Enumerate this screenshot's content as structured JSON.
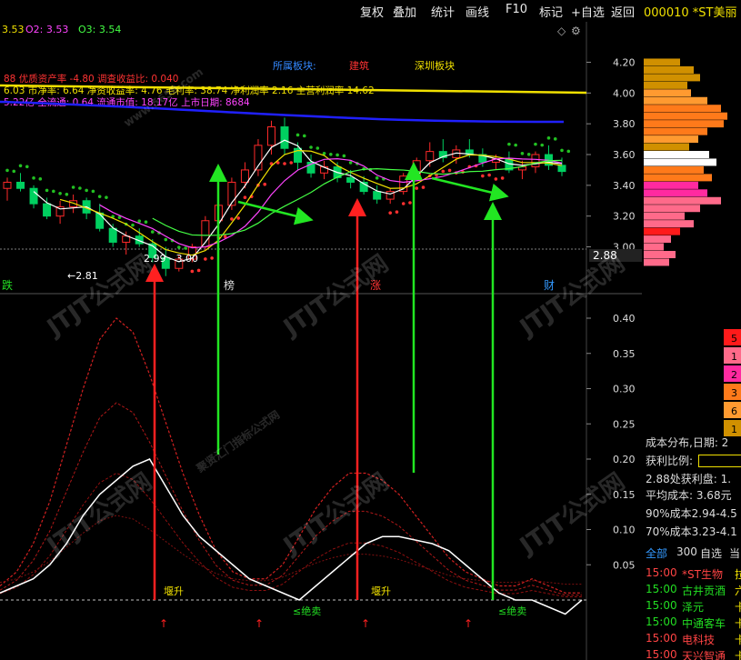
{
  "topbar": {
    "items": [
      "复权",
      "叠加",
      "统计",
      "画线",
      "F10",
      "标记",
      "+自选",
      "返回"
    ],
    "code": "000010 *ST美丽"
  },
  "ma_line": {
    "o1": "3.53",
    "o2": "O2: 3.53",
    "o3": "O3: 3.54"
  },
  "sector_row": {
    "label": "所属板块:",
    "sector1": "建筑",
    "sector2": "深圳板块"
  },
  "fund_rows": [
    "88 优质资产率 -4.80 调查收益比: 0.040",
    "6.03 市净率: 6.64 净资收益率: 4.76 毛利率: 38.74 净利润率 2.16 主营利润率 14.62",
    "5.22亿 全流通: 0.64 流通市值: 18.17亿 上市日期: 8684"
  ],
  "price_axis": [
    "4.20",
    "4.00",
    "3.80",
    "3.60",
    "3.40",
    "3.20",
    "3.00"
  ],
  "current_price": "2.88",
  "price_annotations": {
    "low_label": "←2.81",
    "range_label": "2.99 - 3.00"
  },
  "event_markers": [
    "跌",
    "榜",
    "涨",
    "财"
  ],
  "indicator_axis": [
    "0.40",
    "0.35",
    "0.30",
    "0.25",
    "0.20",
    "0.15",
    "0.10",
    "0.05"
  ],
  "indicator_labels": {
    "buy1": "堰升",
    "sell1": "≤绝卖",
    "buy2": "堰升",
    "sell2": "≤绝卖"
  },
  "cost_legend": [
    "5",
    "1",
    "2",
    "3",
    "6",
    "1"
  ],
  "cost_panel": {
    "date_line": "成本分布,日期: 2",
    "profit_label": "获利比例:",
    "profit_at": "2.88处获利盘: 1.",
    "avg_cost": "平均成本: 3.68元",
    "cost90": "90%成本2.94-4.5",
    "cost70": "70%成本3.23-4.1"
  },
  "stock_list": {
    "tabs": [
      "全部",
      "300",
      "自选",
      "当"
    ],
    "rows": [
      {
        "time": "15:00",
        "name": "*ST生物",
        "tail": "拉"
      },
      {
        "time": "15:00",
        "name": "古井贡酒",
        "tail": "六"
      },
      {
        "time": "15:00",
        "name": "泽元",
        "tail": "卡"
      },
      {
        "time": "15:00",
        "name": "中通客车",
        "tail": "卡"
      },
      {
        "time": "15:00",
        "name": "电科技",
        "tail": "卡"
      },
      {
        "time": "15:00",
        "name": "天兴智通",
        "tail": "卡"
      }
    ]
  },
  "watermark": {
    "brand": "JTJT公式网",
    "url": "www.5658.com",
    "slogan": "聚贤汇门指标公式网"
  },
  "colors": {
    "up": "#ff2a2a",
    "down": "#00d060",
    "ma_yellow": "#f0e000",
    "ma_blue": "#2020ff",
    "arrow_green": "#22e622",
    "arrow_red": "#ff2020",
    "white_line": "#ffffff",
    "dots_green": "#22c022"
  },
  "chart_data": {
    "type": "candlestick",
    "price_range": [
      2.8,
      4.25
    ],
    "candles": [
      [
        3.38,
        3.45,
        3.3,
        3.42
      ],
      [
        3.42,
        3.48,
        3.36,
        3.38
      ],
      [
        3.38,
        3.4,
        3.25,
        3.28
      ],
      [
        3.28,
        3.32,
        3.18,
        3.2
      ],
      [
        3.2,
        3.3,
        3.15,
        3.26
      ],
      [
        3.26,
        3.34,
        3.22,
        3.3
      ],
      [
        3.3,
        3.32,
        3.18,
        3.22
      ],
      [
        3.22,
        3.28,
        3.1,
        3.12
      ],
      [
        3.12,
        3.15,
        3.0,
        3.03
      ],
      [
        3.03,
        3.1,
        2.95,
        3.07
      ],
      [
        3.07,
        3.12,
        3.0,
        3.02
      ],
      [
        3.02,
        3.05,
        2.9,
        2.93
      ],
      [
        2.93,
        3.0,
        2.81,
        2.86
      ],
      [
        2.86,
        2.95,
        2.84,
        2.92
      ],
      [
        2.92,
        3.02,
        2.9,
        3.0
      ],
      [
        3.0,
        3.2,
        2.98,
        3.17
      ],
      [
        3.17,
        3.3,
        3.12,
        3.27
      ],
      [
        3.27,
        3.45,
        3.24,
        3.42
      ],
      [
        3.42,
        3.55,
        3.38,
        3.5
      ],
      [
        3.5,
        3.7,
        3.46,
        3.66
      ],
      [
        3.66,
        3.82,
        3.6,
        3.78
      ],
      [
        3.78,
        3.84,
        3.6,
        3.64
      ],
      [
        3.64,
        3.68,
        3.5,
        3.55
      ],
      [
        3.55,
        3.6,
        3.45,
        3.48
      ],
      [
        3.48,
        3.56,
        3.44,
        3.52
      ],
      [
        3.52,
        3.55,
        3.42,
        3.45
      ],
      [
        3.45,
        3.5,
        3.38,
        3.42
      ],
      [
        3.42,
        3.46,
        3.34,
        3.36
      ],
      [
        3.36,
        3.4,
        3.28,
        3.31
      ],
      [
        3.31,
        3.38,
        3.28,
        3.36
      ],
      [
        3.36,
        3.48,
        3.34,
        3.46
      ],
      [
        3.46,
        3.58,
        3.44,
        3.56
      ],
      [
        3.56,
        3.68,
        3.52,
        3.62
      ],
      [
        3.62,
        3.7,
        3.55,
        3.58
      ],
      [
        3.58,
        3.66,
        3.54,
        3.63
      ],
      [
        3.63,
        3.7,
        3.58,
        3.6
      ],
      [
        3.6,
        3.64,
        3.52,
        3.55
      ],
      [
        3.55,
        3.6,
        3.5,
        3.57
      ],
      [
        3.57,
        3.62,
        3.48,
        3.5
      ],
      [
        3.5,
        3.56,
        3.44,
        3.52
      ],
      [
        3.52,
        3.62,
        3.48,
        3.6
      ],
      [
        3.6,
        3.66,
        3.5,
        3.53
      ],
      [
        3.53,
        3.58,
        3.46,
        3.49
      ]
    ],
    "indicator_white": [
      0.01,
      0.02,
      0.03,
      0.05,
      0.08,
      0.12,
      0.15,
      0.17,
      0.19,
      0.2,
      0.16,
      0.12,
      0.09,
      0.07,
      0.05,
      0.03,
      0.02,
      0.01,
      0.0,
      0.02,
      0.04,
      0.06,
      0.08,
      0.09,
      0.09,
      0.085,
      0.08,
      0.07,
      0.05,
      0.03,
      0.01,
      0.0,
      0.0,
      -0.01,
      -0.02,
      0.0
    ],
    "indicator_red_top": [
      0.02,
      0.04,
      0.08,
      0.14,
      0.22,
      0.3,
      0.37,
      0.4,
      0.38,
      0.32,
      0.25,
      0.18,
      0.12,
      0.07,
      0.04,
      0.03,
      0.03,
      0.05,
      0.09,
      0.13,
      0.16,
      0.18,
      0.18,
      0.17,
      0.15,
      0.12,
      0.09,
      0.06,
      0.04,
      0.03,
      0.02,
      0.02,
      0.03,
      0.02,
      0.01,
      0.01
    ]
  }
}
